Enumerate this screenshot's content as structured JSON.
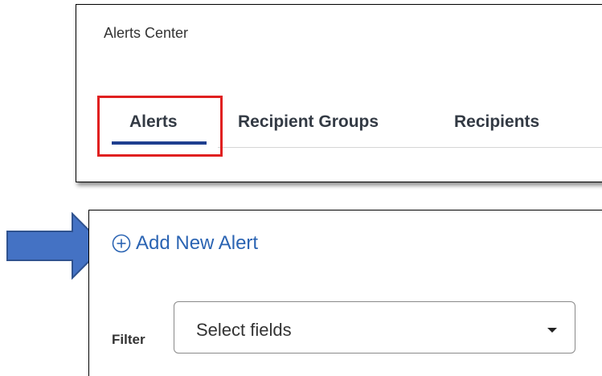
{
  "app": {
    "title": "Alerts Center"
  },
  "tabs": [
    {
      "label": "Alerts",
      "active": true
    },
    {
      "label": "Recipient Groups",
      "active": false
    },
    {
      "label": "Recipients",
      "active": false
    }
  ],
  "actions": {
    "add_new_alert": "Add New Alert"
  },
  "filter": {
    "label": "Filter",
    "placeholder": "Select fields"
  },
  "icons": {
    "add": "plus-circle-icon",
    "dropdown": "caret-down-icon",
    "pointer": "arrow-right-icon"
  },
  "colors": {
    "tab_active_underline": "#1f3f8f",
    "highlight_box": "#e02020",
    "link": "#2b64b3",
    "arrow_fill": "#4472c4"
  }
}
